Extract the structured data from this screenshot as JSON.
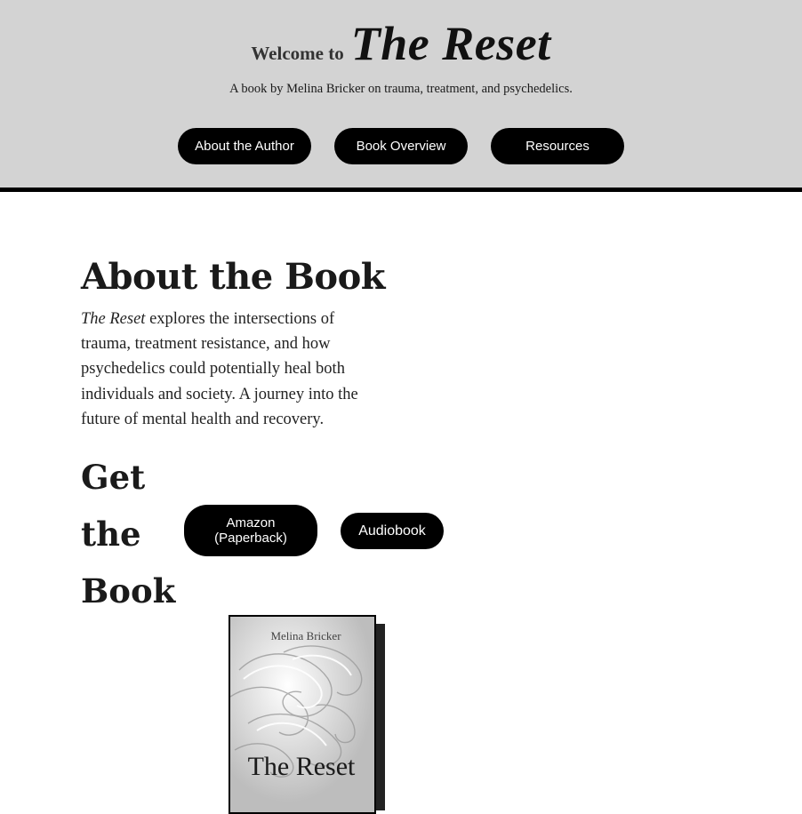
{
  "header": {
    "welcome": "Welcome to",
    "title": "The Reset",
    "tagline": "A book by Melina Bricker on trauma, treatment, and psychedelics."
  },
  "nav": {
    "items": [
      {
        "label": "About the Author"
      },
      {
        "label": "Book Overview"
      },
      {
        "label": "Resources"
      }
    ]
  },
  "about": {
    "heading": "About the Book",
    "title_em": "The Reset",
    "body": " explores the intersections of trauma, treatment resistance, and how psychedelics could potentially heal both individuals and society. A journey into the future of mental health and recovery."
  },
  "get": {
    "heading": "Get the Book",
    "amazon_label": "Amazon\n(Paperback)",
    "audio_label": "Audiobook"
  },
  "cover": {
    "author": "Melina Bricker",
    "title": "The Reset"
  },
  "colors": {
    "header_bg": "#d3d3d3",
    "button_bg": "#000000",
    "button_text": "#ffffff"
  }
}
